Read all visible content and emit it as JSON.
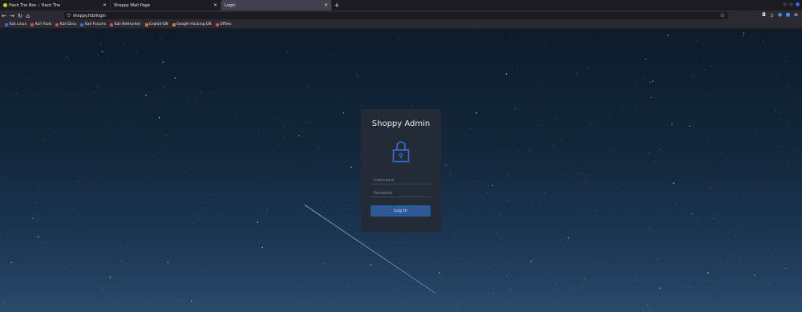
{
  "browser": {
    "tabs": [
      {
        "label": "Hack The Box :: Hack The"
      },
      {
        "label": "Shoppy Wait Page"
      },
      {
        "label": "Login"
      }
    ],
    "new_tab_label": "+",
    "url": "shoppy.htb/login",
    "bookmarks": [
      {
        "label": "Kali Linux",
        "icon": "kali-icon",
        "color": "#2f6fd6"
      },
      {
        "label": "Kali Tools",
        "icon": "kali-tools-icon",
        "color": "#d04a4a"
      },
      {
        "label": "Kali Docs",
        "icon": "kali-docs-icon",
        "color": "#d04a4a"
      },
      {
        "label": "Kali Forums",
        "icon": "kali-forums-icon",
        "color": "#2f6fd6"
      },
      {
        "label": "Kali NetHunter",
        "icon": "nethunter-icon",
        "color": "#d04a4a"
      },
      {
        "label": "Exploit-DB",
        "icon": "exploit-db-icon",
        "color": "#e5722a"
      },
      {
        "label": "Google Hacking DB",
        "icon": "ghdb-icon",
        "color": "#e5722a"
      },
      {
        "label": "OffSec",
        "icon": "offsec-icon",
        "color": "#d04a4a"
      }
    ]
  },
  "login": {
    "title": "Shoppy Admin",
    "lock_icon": "lock-icon",
    "accent": "#2f6fd6",
    "username_placeholder": "Username",
    "password_placeholder": "Password",
    "button_label": "Log In"
  }
}
